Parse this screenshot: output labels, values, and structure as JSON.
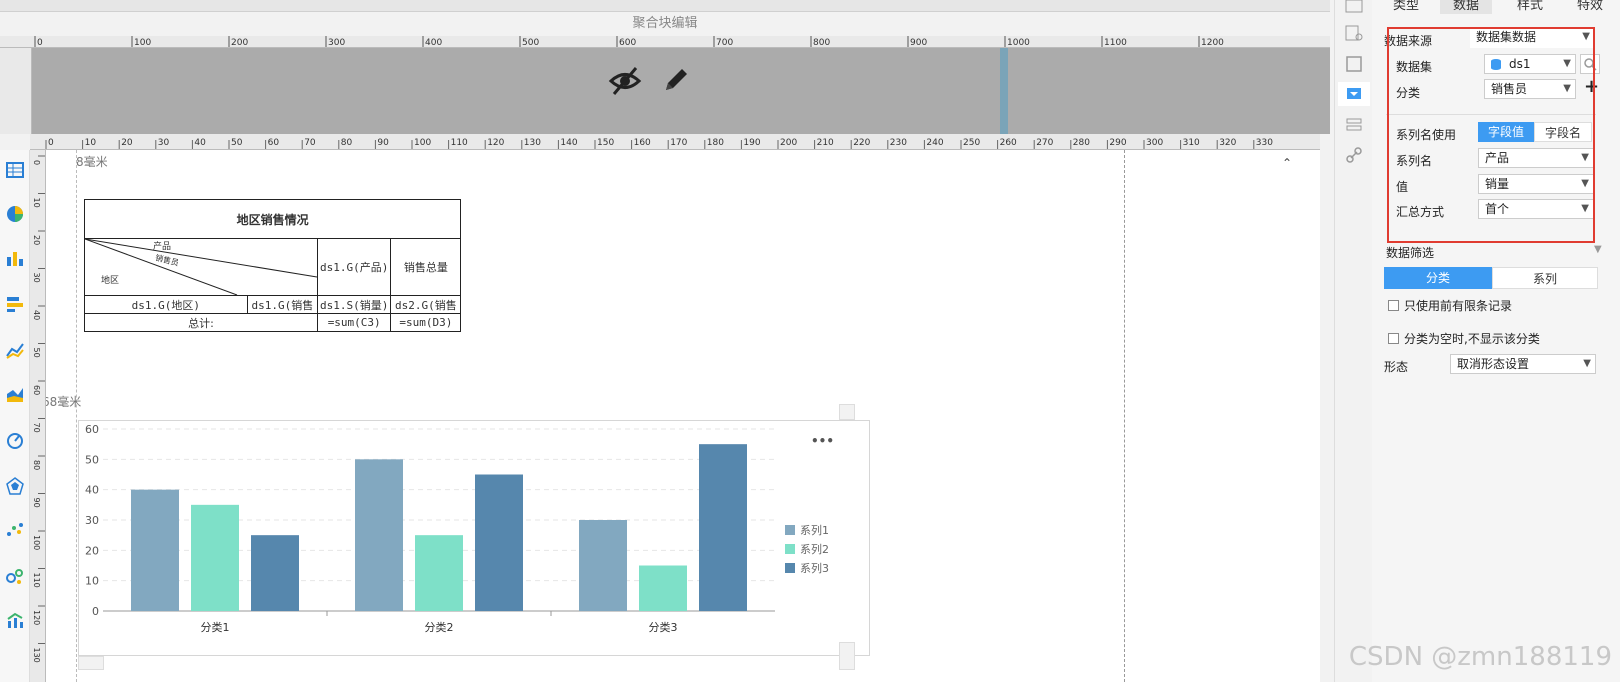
{
  "header": {
    "title": "聚合块编辑"
  },
  "ruler_top": {
    "ticks": [
      "0",
      "100",
      "200",
      "300",
      "400",
      "500",
      "600",
      "700",
      "800",
      "900",
      "1000",
      "1100",
      "1200"
    ]
  },
  "ruler_mm": {
    "ticks": [
      "0",
      "10",
      "20",
      "30",
      "40",
      "50",
      "60",
      "70",
      "80",
      "90",
      "100",
      "110",
      "120",
      "130",
      "140",
      "150",
      "160",
      "170",
      "180",
      "190",
      "200",
      "210",
      "220",
      "230",
      "240",
      "250",
      "260",
      "270",
      "280",
      "290",
      "300",
      "310",
      "320",
      "330"
    ]
  },
  "ruler_left": {
    "ticks": [
      "0",
      "10",
      "20",
      "30",
      "40",
      "50",
      "60",
      "70",
      "80",
      "90",
      "100",
      "110",
      "120",
      "130"
    ]
  },
  "canvas": {
    "mark_top": "8毫米",
    "mark_chart": "68毫米"
  },
  "report_table": {
    "title": "地区销售情况",
    "diag_product": "产品",
    "diag_salesman": "销售员",
    "diag_region": "地区",
    "col_product": "ds1.G(产品)",
    "col_total": "销售总量",
    "cell_region": "ds1.G(地区)",
    "cell_salesman": "ds1.G(销售",
    "cell_sales": "ds1.S(销量)",
    "cell_total": "ds2.G(销售",
    "total_label": "总计:",
    "sum_c": "=sum(C3)",
    "sum_d": "=sum(D3)"
  },
  "chart_data": {
    "type": "bar",
    "categories": [
      "分类1",
      "分类2",
      "分类3"
    ],
    "series": [
      {
        "name": "系列1",
        "values": [
          40,
          50,
          30
        ],
        "color": "#82a8c0"
      },
      {
        "name": "系列2",
        "values": [
          35,
          25,
          15
        ],
        "color": "#7ee0c8"
      },
      {
        "name": "系列3",
        "values": [
          25,
          45,
          55
        ],
        "color": "#5687ad"
      }
    ],
    "ylim": [
      0,
      60
    ],
    "yticks": [
      0,
      10,
      20,
      30,
      40,
      50,
      60
    ],
    "grid": true,
    "legend": "right",
    "menu": "•••"
  },
  "panel": {
    "tabs": [
      "类型",
      "数据",
      "样式",
      "特效"
    ],
    "data_source_label": "数据来源",
    "data_source_value": "数据集数据",
    "dataset_label": "数据集",
    "dataset_value": "ds1",
    "category_label": "分类",
    "category_value": "销售员",
    "series_use_label": "系列名使用",
    "seg_field_value": "字段值",
    "seg_field_name": "字段名",
    "series_name_label": "系列名",
    "series_name_value": "产品",
    "value_label": "值",
    "value_value": "销量",
    "summary_label": "汇总方式",
    "summary_value": "首个",
    "filter_label": "数据筛选",
    "filter_tab_category": "分类",
    "filter_tab_series": "系列",
    "check_limit": "只使用前有限条记录",
    "check_empty": "分类为空时,不显示该分类",
    "form_label": "形态",
    "form_value": "取消形态设置"
  },
  "watermark": "CSDN @zmn188119",
  "colors": {
    "accent": "#3d9bf2",
    "highlight": "#e03c31"
  }
}
